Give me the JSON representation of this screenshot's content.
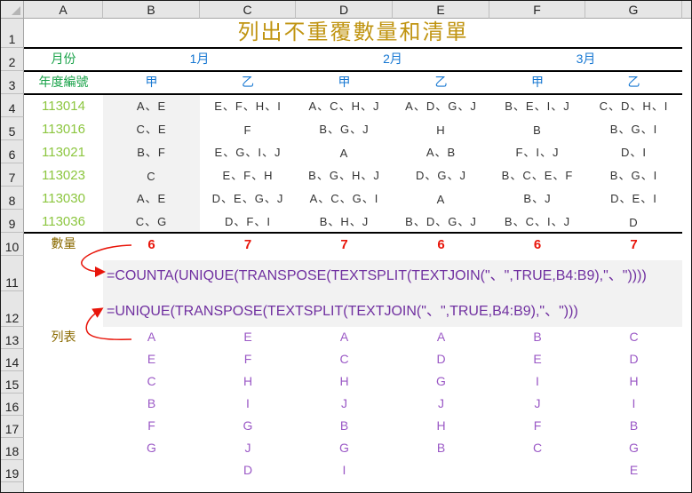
{
  "sheet": {
    "columns": [
      "A",
      "B",
      "C",
      "D",
      "E",
      "F",
      "G"
    ],
    "rows": [
      "1",
      "2",
      "3",
      "4",
      "5",
      "6",
      "7",
      "8",
      "9",
      "10",
      "11",
      "12",
      "13",
      "14",
      "15",
      "16",
      "17",
      "18",
      "19"
    ]
  },
  "title": "列出不重覆數量和清單",
  "header": {
    "month_label": "月份",
    "months": [
      "1月",
      "2月",
      "3月"
    ],
    "id_label": "年度編號",
    "groups": [
      "甲",
      "乙",
      "甲",
      "乙",
      "甲",
      "乙"
    ]
  },
  "table": {
    "rows": [
      {
        "id": "113014",
        "values": [
          "A、E",
          "E、F、H、I",
          "A、C、H、J",
          "A、D、G、J",
          "B、E、I、J",
          "C、D、H、I"
        ]
      },
      {
        "id": "113016",
        "values": [
          "C、E",
          "F",
          "B、G、J",
          "H",
          "B",
          "B、G、I"
        ]
      },
      {
        "id": "113021",
        "values": [
          "B、F",
          "E、G、I、J",
          "A",
          "A、B",
          "F、I、J",
          "D、I"
        ]
      },
      {
        "id": "113023",
        "values": [
          "C",
          "E、F、H",
          "B、G、H、J",
          "D、G、J",
          "B、C、E、F",
          "B、G、I"
        ]
      },
      {
        "id": "113030",
        "values": [
          "A、E",
          "D、E、G、J",
          "A、C、G、I",
          "A",
          "B、J",
          "D、E、I"
        ]
      },
      {
        "id": "113036",
        "values": [
          "C、G",
          "D、F、I",
          "B、H、J",
          "B、D、G、J",
          "B、C、I、J",
          "D"
        ]
      }
    ]
  },
  "count": {
    "label": "數量",
    "values": [
      "6",
      "7",
      "7",
      "6",
      "6",
      "7"
    ]
  },
  "formulas": {
    "count_formula": "=COUNTA(UNIQUE(TRANSPOSE(TEXTSPLIT(TEXTJOIN(\"、\",TRUE,B4:B9),\"、\"))))",
    "list_formula": "=UNIQUE(TRANSPOSE(TEXTSPLIT(TEXTJOIN(\"、\",TRUE,B4:B9),\"、\")))"
  },
  "list": {
    "label": "列表",
    "columns": [
      [
        "A",
        "E",
        "C",
        "B",
        "F",
        "G",
        ""
      ],
      [
        "E",
        "F",
        "H",
        "I",
        "G",
        "J",
        "D"
      ],
      [
        "A",
        "C",
        "H",
        "J",
        "B",
        "G",
        "I"
      ],
      [
        "A",
        "D",
        "G",
        "J",
        "H",
        "B",
        ""
      ],
      [
        "B",
        "E",
        "I",
        "J",
        "F",
        "C",
        ""
      ],
      [
        "C",
        "D",
        "H",
        "I",
        "B",
        "G",
        "E"
      ]
    ]
  },
  "colors": {
    "title": "#c09411",
    "label_green": "#1aa34a",
    "header_blue": "#1677d2",
    "id_green": "#8cc63f",
    "count_red": "#e8150a",
    "formula_purple": "#7030a0",
    "list_purple": "#9b59c6",
    "arrow_red": "#e8150a"
  }
}
